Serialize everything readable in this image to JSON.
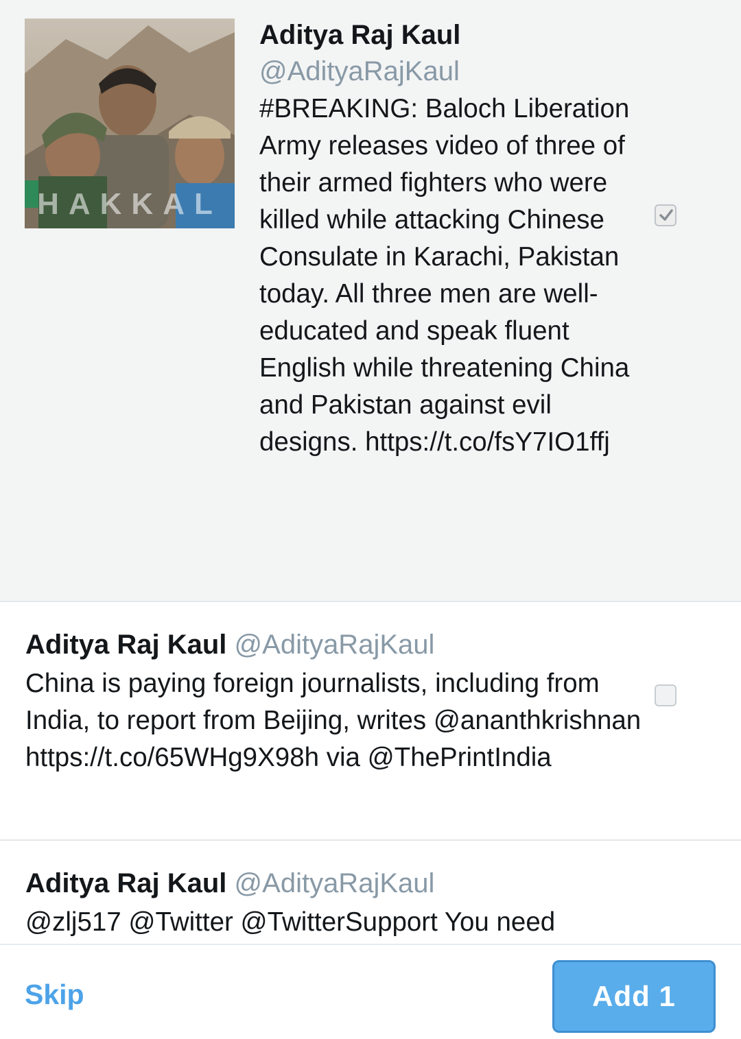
{
  "tweets": [
    {
      "name": "Aditya Raj Kaul",
      "handle": "@AdityaRajKaul",
      "text": "#BREAKING: Baloch Liberation Army releases video of three of their armed fighters who were killed while attacking Chinese Consulate in Karachi, Pakistan today. All three men are well-educated and speak fluent English while threatening China and Pakistan against evil designs. https://t.co/fsY7IO1ffj",
      "selected": true,
      "image_watermark": "HAKKAL"
    },
    {
      "name": "Aditya Raj Kaul",
      "handle": "@AdityaRajKaul",
      "text": "China is paying foreign journalists, including from India, to report from Beijing, writes @ananthkrishnan https://t.co/65WHg9X98h via @ThePrintIndia",
      "selected": false
    },
    {
      "name": "Aditya Raj Kaul",
      "handle": "@AdityaRajKaul",
      "text": "@zlj517 @Twitter @TwitterSupport You need"
    }
  ],
  "footer": {
    "skip_label": "Skip",
    "add_label": "Add 1"
  },
  "colors": {
    "accent": "#59adeb",
    "handle": "#8899a6",
    "selected_bg": "#f3f4f4"
  },
  "icons": {
    "checkmark": "check-icon"
  }
}
